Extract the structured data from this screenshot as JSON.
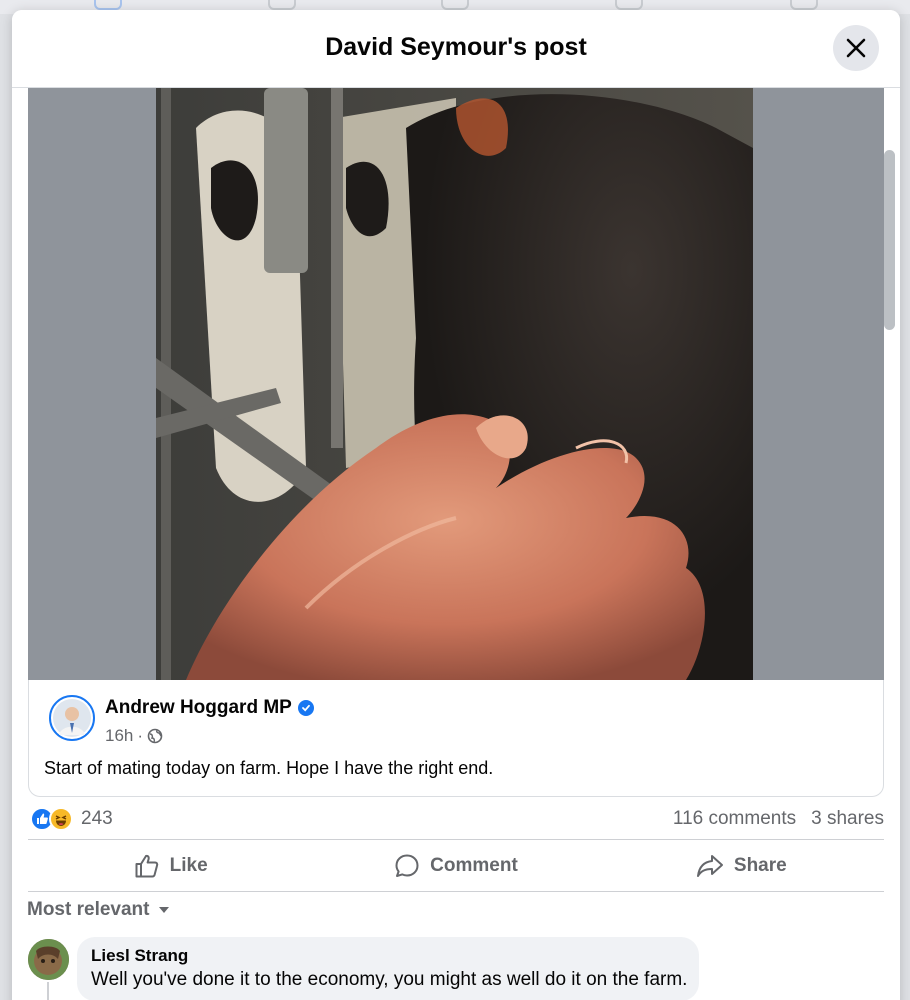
{
  "modal": {
    "title": "David Seymour's post"
  },
  "shared_post": {
    "author": "Andrew Hoggard MP",
    "time": "16h",
    "separator": "·",
    "text": "Start of mating today on farm. Hope I have the right end."
  },
  "stats": {
    "reaction_count": "243",
    "comments": "116 comments",
    "shares": "3 shares"
  },
  "actions": {
    "like": "Like",
    "comment": "Comment",
    "share": "Share"
  },
  "comments_sort": {
    "label": "Most relevant"
  },
  "comments": [
    {
      "author": "Liesl Strang",
      "text": "Well you've done it to the economy, you might as well do it on the farm."
    }
  ],
  "colors": {
    "accent": "#1877f2",
    "secondary_text": "#65676b",
    "bubble": "#f0f2f5",
    "haha": "#f7b928"
  }
}
